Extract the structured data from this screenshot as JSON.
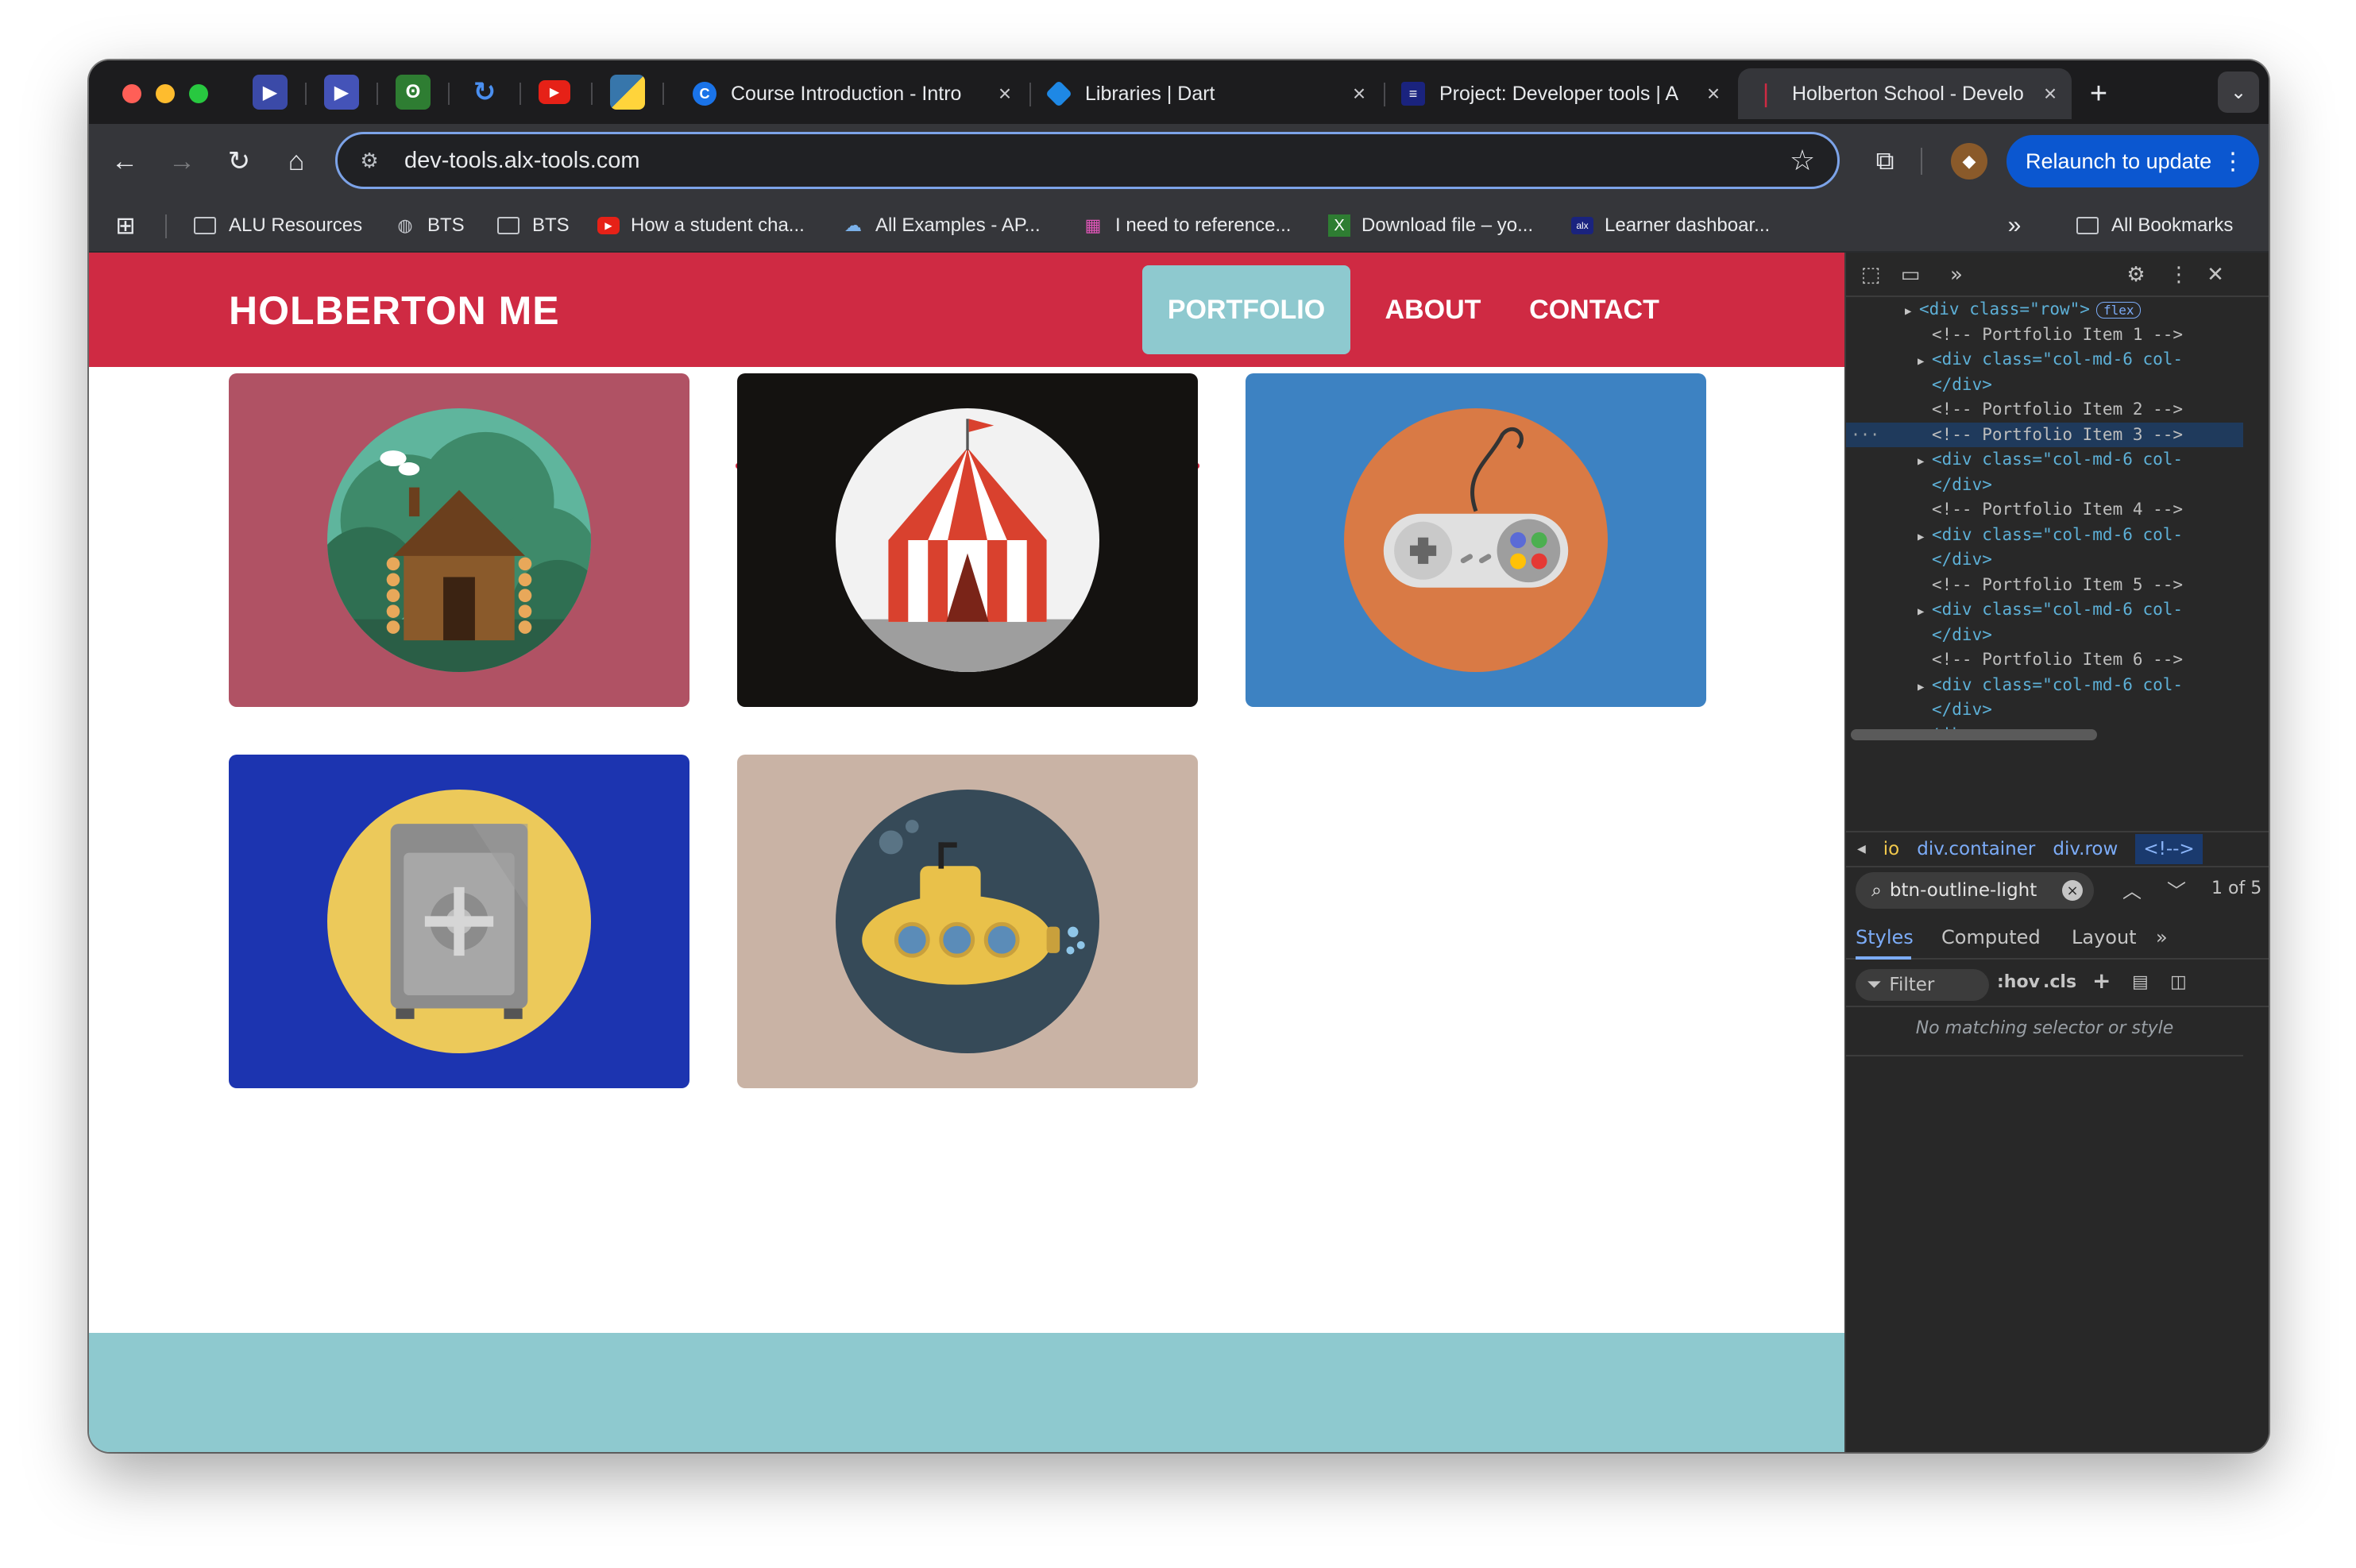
{
  "browser": {
    "pinned_tabs": [
      {
        "icon": "play-icon",
        "color": "#3b4aa8"
      },
      {
        "icon": "play-icon",
        "color": "#4453b8"
      },
      {
        "icon": "owl-icon",
        "color": "#2e7d32"
      },
      {
        "icon": "sync-icon",
        "color": "#1565c0"
      },
      {
        "icon": "youtube-icon",
        "color": "#e62117"
      },
      {
        "icon": "python-icon",
        "color": "#3776ab"
      }
    ],
    "tabs": [
      {
        "title": "Course Introduction - Intro",
        "favicon_color": "#1a73e8",
        "favicon": "C"
      },
      {
        "title": "Libraries | Dart",
        "favicon_color": "#1e88e5",
        "favicon": "◆"
      },
      {
        "title": "Project: Developer tools | A",
        "favicon_color": "#1a237e",
        "favicon": "≡"
      },
      {
        "title": "Holberton School - Develo",
        "favicon_color": "#cf2a43",
        "favicon": "ꟾ"
      }
    ],
    "new_tab_label": "+",
    "url": "dev-tools.alx-tools.com",
    "relaunch_label": "Relaunch to update",
    "bookmarks": [
      {
        "label": "ALU Resources",
        "type": "folder"
      },
      {
        "label": "BTS",
        "type": "globe"
      },
      {
        "label": "BTS",
        "type": "folder"
      },
      {
        "label": "How a student cha...",
        "type": "youtube"
      },
      {
        "label": "All Examples - AP...",
        "type": "cloud"
      },
      {
        "label": "I need to reference...",
        "type": "page"
      },
      {
        "label": "Download file – yo...",
        "type": "x"
      },
      {
        "label": "Learner dashboar...",
        "type": "alx"
      }
    ],
    "all_bookmarks_label": "All Bookmarks"
  },
  "site": {
    "brand": "HOLBERTON ME",
    "nav": [
      {
        "label": "PORTFOLIO",
        "active": true
      },
      {
        "label": "ABOUT",
        "active": false
      },
      {
        "label": "CONTACT",
        "active": false
      }
    ],
    "accent": "#cf2a43",
    "teal": "#8ec9cf",
    "portfolio": [
      {
        "name": "cabin",
        "bg": "#b05264"
      },
      {
        "name": "circus-tent",
        "bg": "#141210"
      },
      {
        "name": "game-controller",
        "bg": "#3d82c2"
      },
      {
        "name": "safe",
        "bg": "#1c34b0"
      },
      {
        "name": "submarine",
        "bg": "#c9b3a5"
      }
    ]
  },
  "devtools": {
    "dom_lines": [
      {
        "indent": 4,
        "kind": "tag",
        "text": "<div class=\"row\">",
        "badge": "flex"
      },
      {
        "indent": 5,
        "kind": "comment",
        "text": "<!-- Portfolio Item 1 -->"
      },
      {
        "indent": 5,
        "kind": "tag",
        "text": "<div class=\"col-md-6 col-"
      },
      {
        "indent": 5,
        "kind": "close",
        "text": "</div>"
      },
      {
        "indent": 5,
        "kind": "comment",
        "text": "<!-- Portfolio Item 2 -->"
      },
      {
        "indent": 5,
        "kind": "comment",
        "text": "<!-- Portfolio Item 3 -->",
        "selected": true
      },
      {
        "indent": 5,
        "kind": "tag",
        "text": "<div class=\"col-md-6 col-"
      },
      {
        "indent": 5,
        "kind": "close",
        "text": "</div>"
      },
      {
        "indent": 5,
        "kind": "comment",
        "text": "<!-- Portfolio Item 4 -->"
      },
      {
        "indent": 5,
        "kind": "tag",
        "text": "<div class=\"col-md-6 col-"
      },
      {
        "indent": 5,
        "kind": "close",
        "text": "</div>"
      },
      {
        "indent": 5,
        "kind": "comment",
        "text": "<!-- Portfolio Item 5 -->"
      },
      {
        "indent": 5,
        "kind": "tag",
        "text": "<div class=\"col-md-6 col-"
      },
      {
        "indent": 5,
        "kind": "close",
        "text": "</div>"
      },
      {
        "indent": 5,
        "kind": "comment",
        "text": "<!-- Portfolio Item 6 -->"
      },
      {
        "indent": 5,
        "kind": "tag",
        "text": "<div class=\"col-md-6 col-"
      },
      {
        "indent": 5,
        "kind": "close",
        "text": "</div>"
      },
      {
        "indent": 4,
        "kind": "close",
        "text": "</div>"
      }
    ],
    "breadcrumbs": [
      "io",
      "div.container",
      "div.row",
      "<!-->"
    ],
    "search_query": "btn-outline-light",
    "search_count": "1 of 5",
    "panel_tabs": [
      "Styles",
      "Computed",
      "Layout"
    ],
    "filter_label": "Filter",
    "hov_label": ":hov",
    "cls_label": ".cls",
    "no_match_text": "No matching selector or style"
  }
}
